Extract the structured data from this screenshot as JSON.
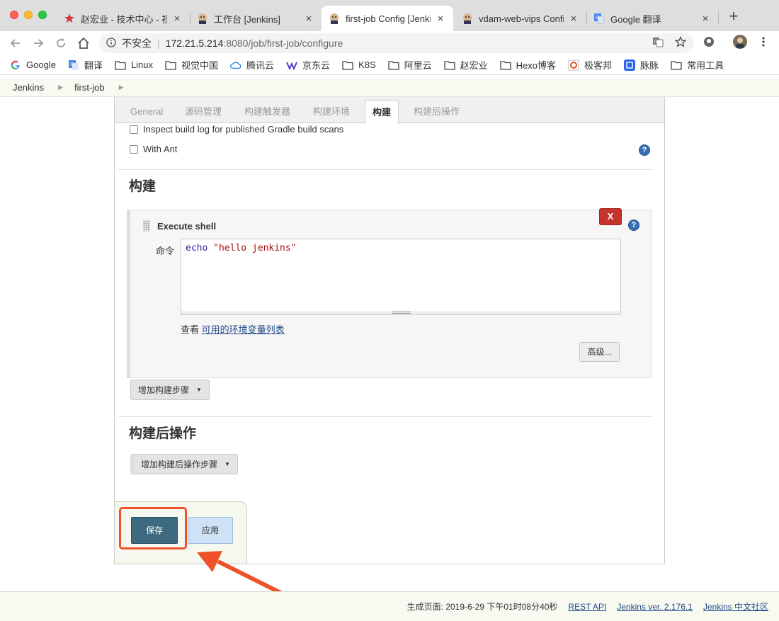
{
  "browser": {
    "tabs": [
      {
        "title": "赵宏业 - 技术中心 - 视"
      },
      {
        "title": "工作台 [Jenkins]"
      },
      {
        "title": "first-job Config [Jenki"
      },
      {
        "title": "vdam-web-vips Confi"
      },
      {
        "title": "Google 翻译"
      }
    ],
    "address": {
      "insecure_label": "不安全",
      "host": "172.21.5.214",
      "path": ":8080/job/first-job/configure"
    },
    "bookmarks": [
      {
        "label": "Google",
        "icon": "google-icon"
      },
      {
        "label": "翻译",
        "icon": "translate-icon"
      },
      {
        "label": "Linux",
        "icon": "folder-icon"
      },
      {
        "label": "视觉中国",
        "icon": "folder-icon"
      },
      {
        "label": "腾讯云",
        "icon": "cloud-icon"
      },
      {
        "label": "京东云",
        "icon": "jd-icon"
      },
      {
        "label": "K8S",
        "icon": "folder-icon"
      },
      {
        "label": "阿里云",
        "icon": "folder-icon"
      },
      {
        "label": "赵宏业",
        "icon": "folder-icon"
      },
      {
        "label": "Hexo博客",
        "icon": "folder-icon"
      },
      {
        "label": "极客邦",
        "icon": "geek-icon"
      },
      {
        "label": "脉脉",
        "icon": "maimai-icon"
      },
      {
        "label": "常用工具",
        "icon": "folder-icon"
      }
    ]
  },
  "breadcrumb": {
    "root": "Jenkins",
    "job": "first-job"
  },
  "config_tabs": [
    {
      "label": "General"
    },
    {
      "label": "源码管理"
    },
    {
      "label": "构建触发器"
    },
    {
      "label": "构建环境"
    },
    {
      "label": "构建"
    },
    {
      "label": "构建后操作"
    }
  ],
  "options": {
    "gradle_scans": "Inspect build log for published Gradle build scans",
    "with_ant": "With Ant"
  },
  "build": {
    "heading": "构建",
    "step_title": "Execute shell",
    "delete_label": "X",
    "command_label": "命令",
    "command_keyword": "echo",
    "command_string": "\"hello jenkins\"",
    "env_hint_prefix": "查看",
    "env_hint_link": "可用的环境变量列表",
    "advanced_label": "高级...",
    "add_step_label": "增加构建步骤"
  },
  "post_build": {
    "heading": "构建后操作",
    "add_step_label": "增加构建后操作步骤"
  },
  "actions": {
    "save_label": "保存",
    "apply_label": "应用"
  },
  "help_glyph": "?",
  "footer": {
    "generated": "生成页面: 2019-6-29 下午01时08分40秒",
    "rest_api": "REST API",
    "version": "Jenkins ver. 2.176.1",
    "community": "Jenkins 中文社区"
  },
  "colors": {
    "save": "#3d6a7e",
    "apply": "#cfe1f5",
    "delete": "#c4332e",
    "highlight": "#f0512a"
  }
}
